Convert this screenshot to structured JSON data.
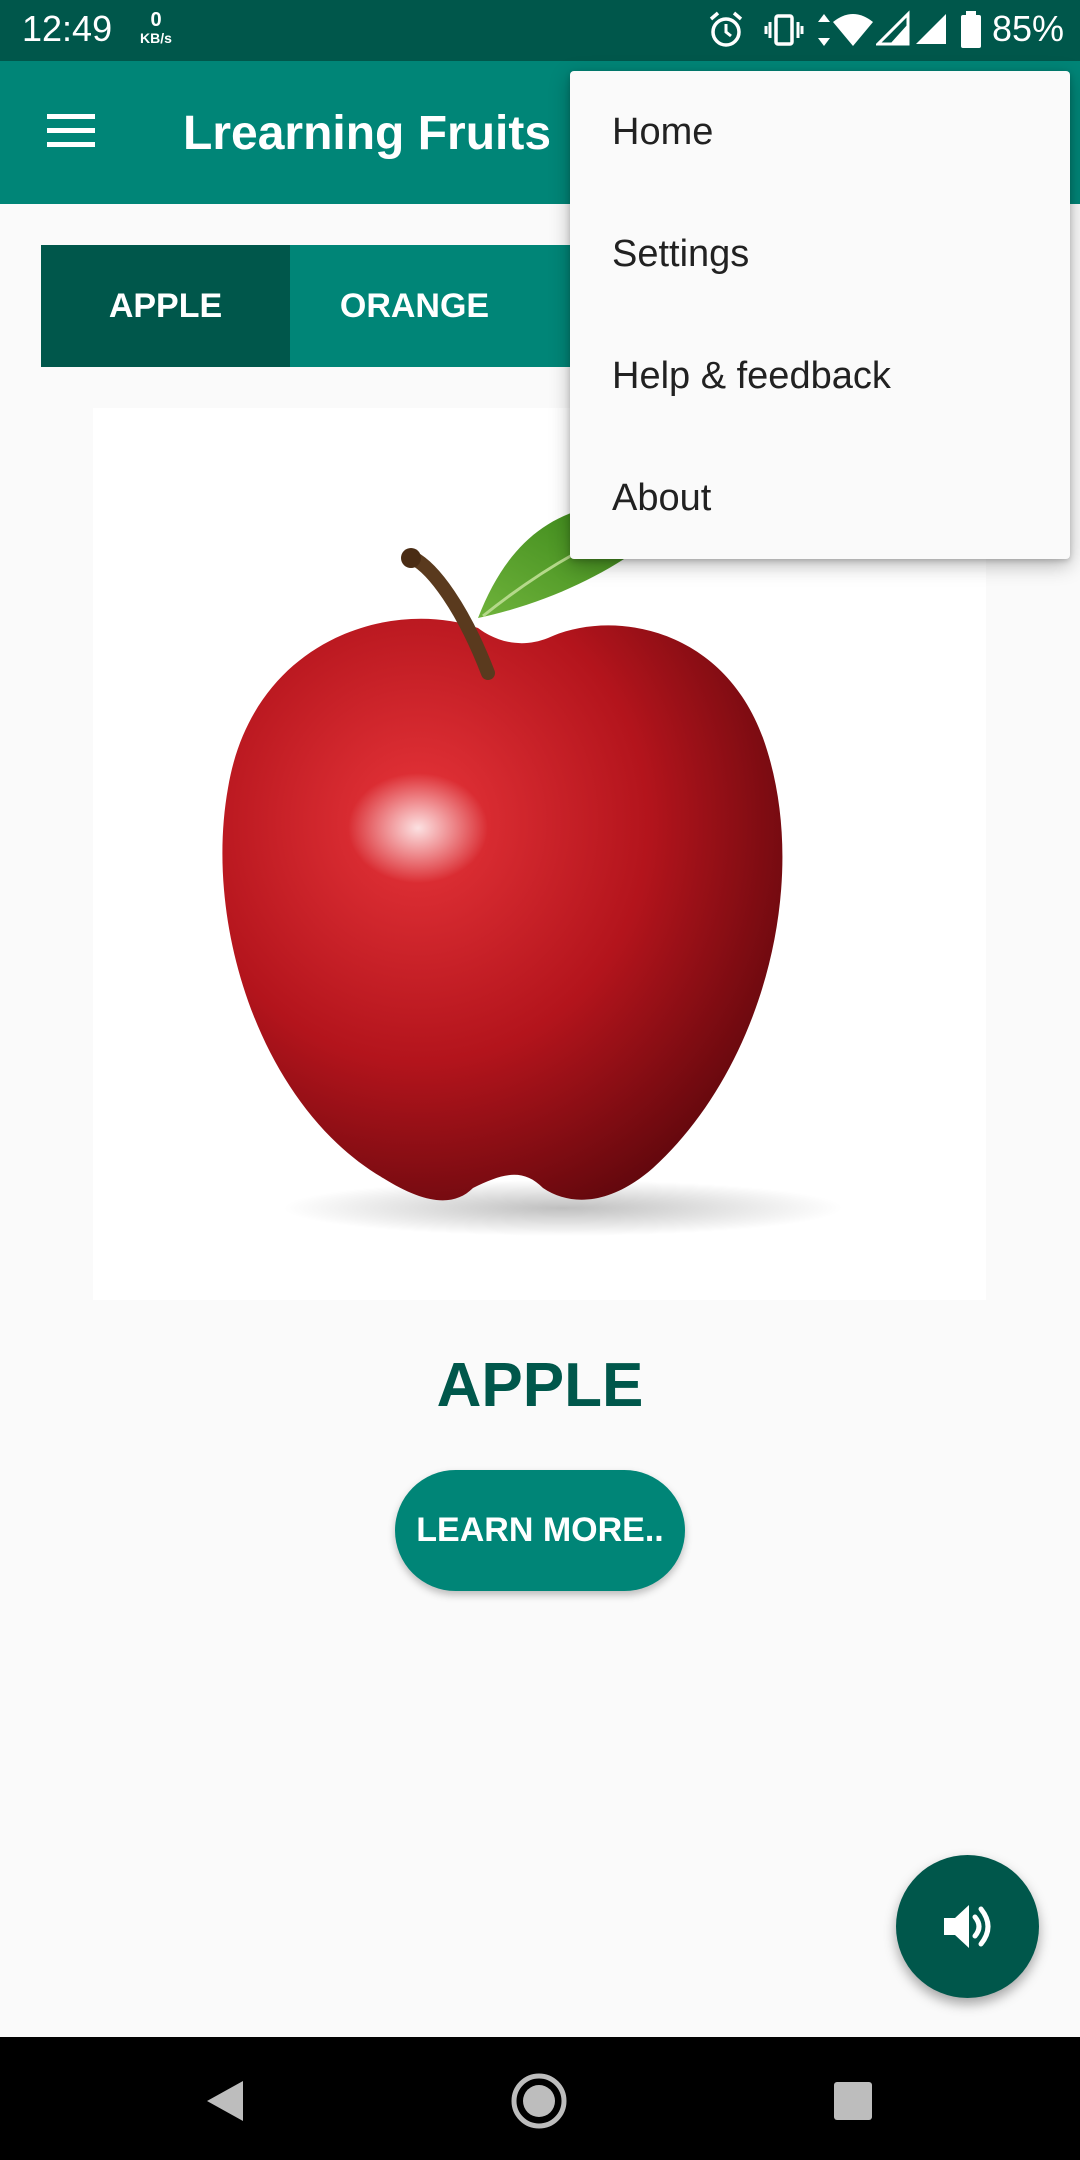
{
  "status_bar": {
    "time": "12:49",
    "net_speed": "0",
    "net_unit": "KB/s",
    "battery": "85%",
    "icons": [
      "alarm-icon",
      "vibrate-icon",
      "data-arrows-icon",
      "wifi-icon",
      "signal-icon",
      "signal-icon",
      "battery-icon"
    ]
  },
  "app_bar": {
    "title": "Lrearning Fruits",
    "menu_icon": "hamburger-menu-icon"
  },
  "tabs": [
    {
      "label": "APPLE",
      "active": true
    },
    {
      "label": "ORANGE",
      "active": false
    },
    {
      "label": "",
      "active": false
    },
    {
      "label": "",
      "active": false
    }
  ],
  "content": {
    "fruit_name": "APPLE",
    "learn_more_label": "LEARN MORE..",
    "image": "apple-image"
  },
  "fab": {
    "icon": "volume-icon"
  },
  "overflow_menu": {
    "items": [
      "Home",
      "Settings",
      "Help & feedback",
      "About"
    ]
  },
  "nav_bar": {
    "icons": [
      "back-icon",
      "home-icon",
      "recents-icon"
    ]
  },
  "colors": {
    "primary": "#008577",
    "primary_dark": "#00574b",
    "background": "#fafafa"
  }
}
